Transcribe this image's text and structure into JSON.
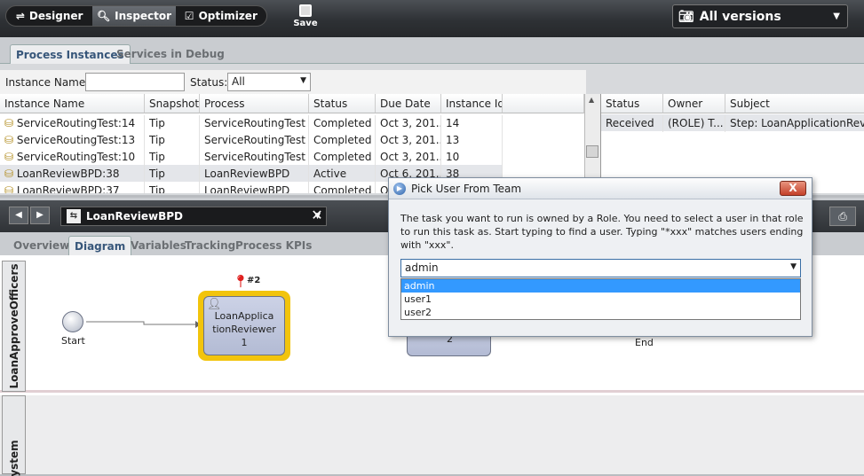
{
  "app": {
    "modes": [
      {
        "label": "Designer",
        "icon": "designer-icon",
        "active": false
      },
      {
        "label": "Inspector",
        "icon": "magnifier-icon",
        "active": true
      },
      {
        "label": "Optimizer",
        "icon": "chart-icon",
        "active": false
      }
    ],
    "save_label": "Save",
    "version_selector": "All versions"
  },
  "instances_panel": {
    "tabs": [
      "Process Instances",
      "Services in Debug"
    ],
    "filter": {
      "instance_name_label": "Instance Name:",
      "instance_name_value": "",
      "status_label": "Status:",
      "status_value": "All"
    },
    "columns": [
      "Instance Name",
      "Snapshot",
      "Process",
      "Status",
      "Due Date",
      "Instance Id"
    ],
    "rows": [
      [
        "ServiceRoutingTest:14",
        "Tip",
        "ServiceRoutingTest",
        "Completed",
        "Oct 3, 201...",
        "14"
      ],
      [
        "ServiceRoutingTest:13",
        "Tip",
        "ServiceRoutingTest",
        "Completed",
        "Oct 3, 201...",
        "13"
      ],
      [
        "ServiceRoutingTest:10",
        "Tip",
        "ServiceRoutingTest",
        "Completed",
        "Oct 3, 201...",
        "10"
      ],
      [
        "LoanReviewBPD:38",
        "Tip",
        "LoanReviewBPD",
        "Active",
        "Oct 6, 201...",
        "38"
      ],
      [
        "LoanReviewBPD:37",
        "Tip",
        "LoanReviewBPD",
        "Completed",
        "Oct ...",
        ""
      ]
    ],
    "task_columns": [
      "Status",
      "Owner",
      "Subject"
    ],
    "task_rows": [
      [
        "Received",
        "(ROLE) T...",
        "Step: LoanApplicationReview"
      ]
    ]
  },
  "diagram": {
    "process_name": "LoanReviewBPD",
    "tabs": [
      "Overview",
      "Diagram",
      "Variables",
      "Tracking",
      "Process KPIs"
    ],
    "lanes": [
      "LoanApproveOfficers",
      "ystem"
    ],
    "start_label": "Start",
    "end_label": "End",
    "task_label": "LoanApplicationReviewer",
    "task_label_lines": [
      "LoanApplica",
      "tionReviewer",
      "1"
    ],
    "task2_label": "2",
    "marker_label": "#2"
  },
  "dialog": {
    "title": "Pick User From Team",
    "close": "X",
    "message": "The task you want to run is owned by a Role. You need to select a user in that role to run this task as. Start typing to find a user.  Typing \"*xxx\" matches users ending with \"xxx\".",
    "selected_user": "admin",
    "options": [
      "admin",
      "user1",
      "user2"
    ]
  }
}
